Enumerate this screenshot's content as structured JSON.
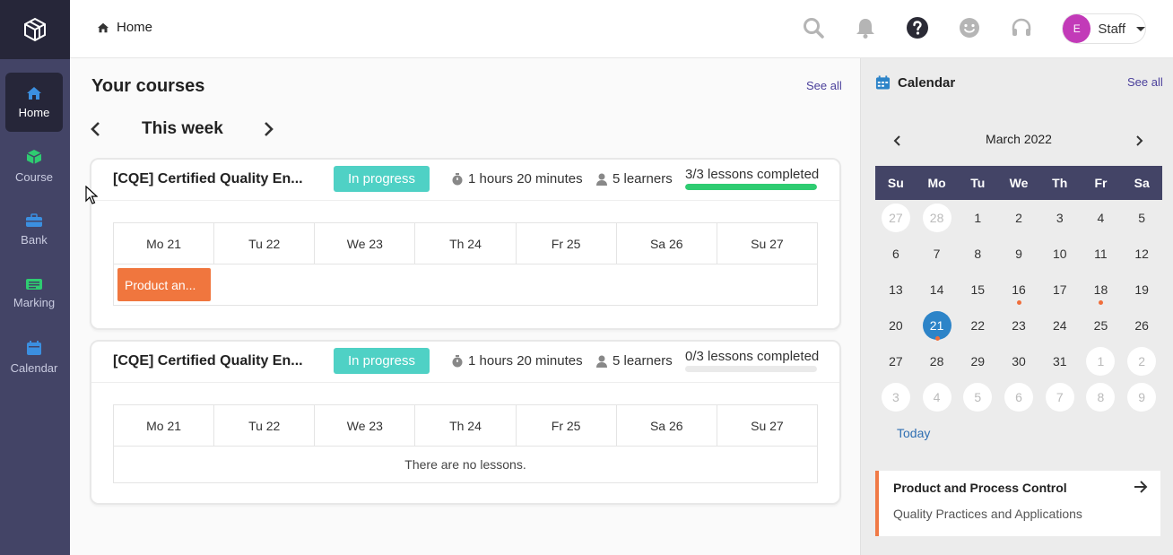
{
  "sidebar": {
    "items": [
      {
        "label": "Home",
        "icon": "home-icon"
      },
      {
        "label": "Course",
        "icon": "cube-icon"
      },
      {
        "label": "Bank",
        "icon": "briefcase-icon"
      },
      {
        "label": "Marking",
        "icon": "marking-icon"
      },
      {
        "label": "Calendar",
        "icon": "calendar-icon"
      }
    ]
  },
  "header": {
    "breadcrumb": "Home",
    "user_initial": "E",
    "user_role": "Staff"
  },
  "main": {
    "title": "Your courses",
    "see_all": "See all",
    "week_label": "This week",
    "courses": [
      {
        "name": "[CQE] Certified Quality En...",
        "status": "In progress",
        "duration": "1 hours 20 minutes",
        "learners": "5 learners",
        "progress_text": "3/3 lessons completed",
        "progress": 1.0,
        "days": [
          "Mo 21",
          "Tu 22",
          "We 23",
          "Th 24",
          "Fr 25",
          "Sa 26",
          "Su 27"
        ],
        "lesson": "Product an..."
      },
      {
        "name": "[CQE] Certified Quality En...",
        "status": "In progress",
        "duration": "1 hours 20 minutes",
        "learners": "5 learners",
        "progress_text": "0/3 lessons completed",
        "progress": 0.0,
        "days": [
          "Mo 21",
          "Tu 22",
          "We 23",
          "Th 24",
          "Fr 25",
          "Sa 26",
          "Su 27"
        ],
        "empty_text": "There are no lessons."
      }
    ]
  },
  "calendar": {
    "title": "Calendar",
    "see_all": "See all",
    "month": "March 2022",
    "weekdays": [
      "Su",
      "Mo",
      "Tu",
      "We",
      "Th",
      "Fr",
      "Sa"
    ],
    "weeks": [
      [
        {
          "d": "27",
          "o": true
        },
        {
          "d": "28",
          "o": true
        },
        {
          "d": "1"
        },
        {
          "d": "2"
        },
        {
          "d": "3"
        },
        {
          "d": "4"
        },
        {
          "d": "5"
        }
      ],
      [
        {
          "d": "6"
        },
        {
          "d": "7"
        },
        {
          "d": "8"
        },
        {
          "d": "9"
        },
        {
          "d": "10"
        },
        {
          "d": "11"
        },
        {
          "d": "12"
        }
      ],
      [
        {
          "d": "13"
        },
        {
          "d": "14"
        },
        {
          "d": "15"
        },
        {
          "d": "16",
          "dot": true
        },
        {
          "d": "17"
        },
        {
          "d": "18",
          "dot": true
        },
        {
          "d": "19"
        }
      ],
      [
        {
          "d": "20"
        },
        {
          "d": "21",
          "today": true,
          "dot": true
        },
        {
          "d": "22"
        },
        {
          "d": "23"
        },
        {
          "d": "24"
        },
        {
          "d": "25"
        },
        {
          "d": "26"
        }
      ],
      [
        {
          "d": "27"
        },
        {
          "d": "28"
        },
        {
          "d": "29"
        },
        {
          "d": "30"
        },
        {
          "d": "31"
        },
        {
          "d": "1",
          "o": true
        },
        {
          "d": "2",
          "o": true
        }
      ],
      [
        {
          "d": "3",
          "o": true
        },
        {
          "d": "4",
          "o": true
        },
        {
          "d": "5",
          "o": true
        },
        {
          "d": "6",
          "o": true
        },
        {
          "d": "7",
          "o": true
        },
        {
          "d": "8",
          "o": true
        },
        {
          "d": "9",
          "o": true
        }
      ]
    ],
    "today_label": "Today",
    "event": {
      "title": "Product and Process Control",
      "subtitle": "Quality Practices and Applications"
    }
  },
  "colors": {
    "sidebar": "#434466",
    "accent": "#2d84c8",
    "status": "#4fd1c5",
    "progress": "#2ecc71",
    "lesson": "#f0763e"
  }
}
